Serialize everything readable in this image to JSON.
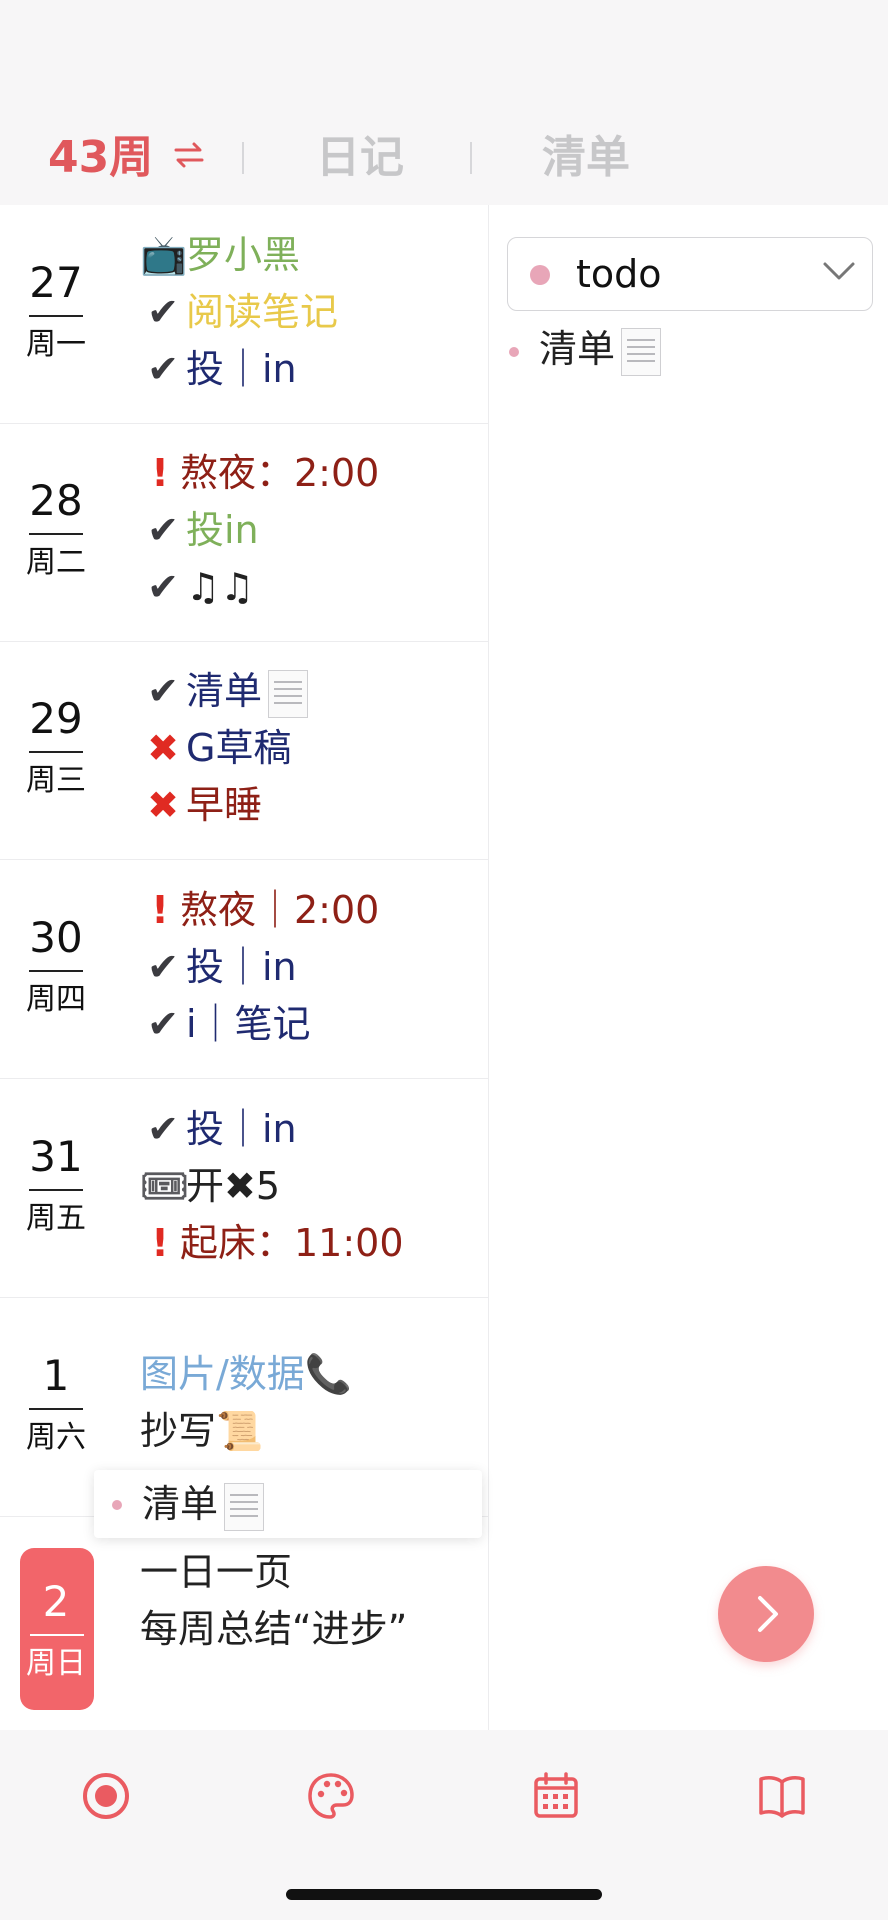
{
  "tabs": {
    "week": "43周",
    "diary": "日记",
    "list": "清单"
  },
  "days": [
    {
      "num": "27",
      "name": "周一",
      "entries": [
        {
          "icon": "tv-icon",
          "glyph": "📺",
          "text": "罗小黑",
          "color": "green"
        },
        {
          "icon": "check-icon",
          "glyph": "✔",
          "text": "阅读笔记",
          "color": "yellow"
        },
        {
          "icon": "check-icon",
          "glyph": "✔",
          "text": "投｜in",
          "color": "navy"
        }
      ]
    },
    {
      "num": "28",
      "name": "周二",
      "entries": [
        {
          "icon": "exclamation-icon",
          "glyph": "!",
          "text": "熬夜：2:00",
          "color": "red"
        },
        {
          "icon": "check-icon",
          "glyph": "✔",
          "text": "投in",
          "color": "green"
        },
        {
          "icon": "check-icon",
          "glyph": "✔",
          "text": "♫♫",
          "color": "dark"
        }
      ]
    },
    {
      "num": "29",
      "name": "周三",
      "entries": [
        {
          "icon": "check-icon",
          "glyph": "✔",
          "text": "清单",
          "color": "navy",
          "receipt": true
        },
        {
          "icon": "cross-icon",
          "glyph": "✖",
          "text": "G草稿",
          "color": "navy"
        },
        {
          "icon": "cross-icon",
          "glyph": "✖",
          "text": "早睡",
          "color": "red"
        }
      ]
    },
    {
      "num": "30",
      "name": "周四",
      "entries": [
        {
          "icon": "exclamation-icon",
          "glyph": "!",
          "text": "熬夜｜2:00",
          "color": "red"
        },
        {
          "icon": "check-icon",
          "glyph": "✔",
          "text": "投｜in",
          "color": "navy"
        },
        {
          "icon": "check-icon",
          "glyph": "✔",
          "text": "i｜笔记",
          "color": "navy"
        }
      ]
    },
    {
      "num": "31",
      "name": "周五",
      "entries": [
        {
          "icon": "check-icon",
          "glyph": "✔",
          "text": "投｜in",
          "color": "navy"
        },
        {
          "icon": "ticket-icon",
          "glyph": "🎟",
          "text": "开✖5",
          "color": "dark"
        },
        {
          "icon": "exclamation-icon",
          "glyph": "!",
          "text": "起床：11:00",
          "color": "red"
        }
      ]
    },
    {
      "num": "1",
      "name": "周六",
      "entries": [
        {
          "icon": "",
          "glyph": "",
          "text": "图片/数据📞",
          "color": "blue"
        },
        {
          "icon": "scroll-icon",
          "glyph": "",
          "text": "抄写📜",
          "color": "dark"
        }
      ]
    }
  ],
  "sunday": {
    "num": "2",
    "name": "周日",
    "entries": [
      "一日一页",
      "每周总结“进步”"
    ]
  },
  "popover": {
    "text": "清单"
  },
  "right_panel": {
    "selected": "todo",
    "items": [
      {
        "text": "清单"
      }
    ]
  },
  "colors": {
    "accent": "#f2656a",
    "green": "#7fb05a",
    "yellow": "#e8c94a",
    "navy": "#1f2a70",
    "red": "#8e2016",
    "blue": "#79a9d6",
    "dark": "#222222"
  },
  "tabbar": [
    "record-icon",
    "palette-icon",
    "calendar-icon",
    "book-icon"
  ]
}
